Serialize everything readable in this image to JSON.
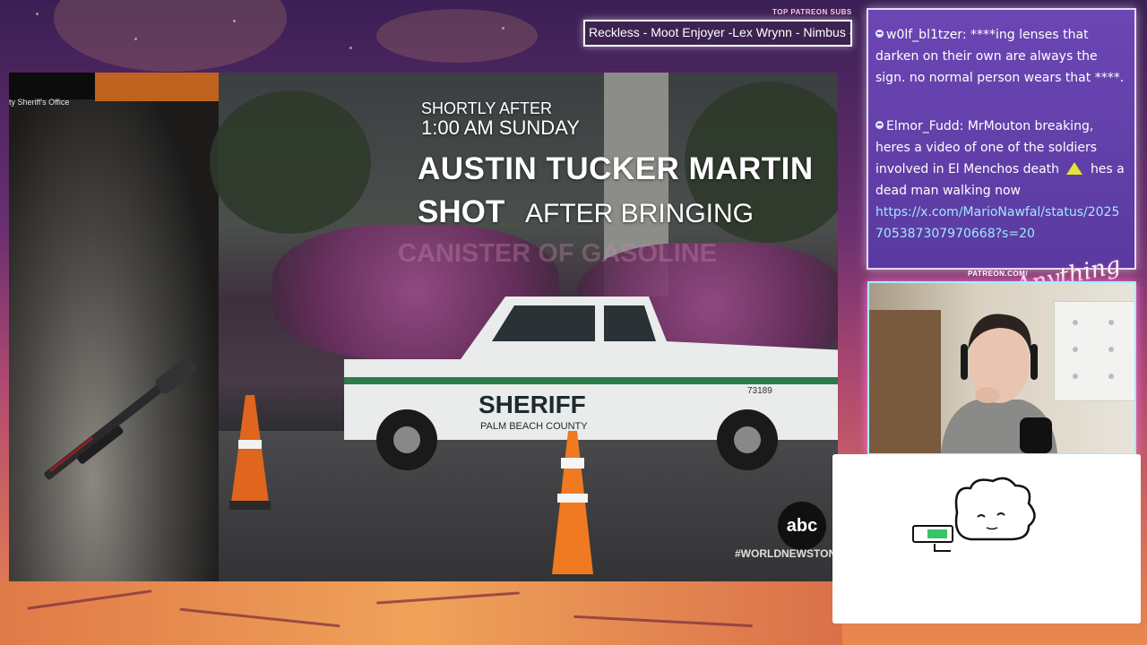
{
  "ticker": {
    "label": "TOP PATREON SUBS",
    "text": "Reckless - Moot Enjoyer -Lex Wrynn - Nimbus - "
  },
  "video": {
    "office_label": "ty Sheriff's Office",
    "news_small1": "SHORTLY AFTER",
    "news_small2": "1:00 AM  SUNDAY",
    "news_big1": "AUSTIN TUCKER MARTIN",
    "news_big2a": "SHOT",
    "news_big2b": "AFTER BRINGING",
    "news_ghost": "CANISTER OF GASOLINE",
    "truck_text": "SHERIFF",
    "truck_subtext": "PALM BEACH COUNTY",
    "truck_number": "73189",
    "network_logo": "abc",
    "hashtag": "#WORLDNEWSTON"
  },
  "chat": {
    "messages": [
      {
        "user": "w0lf_bl1tzer",
        "text": "****ing lenses that darken on their own are always the sign. no normal person wears that ****."
      },
      {
        "user": "Elmor_Fudd",
        "text_before": "MrMouton breaking, heres a video of one of the soldiers involved in El Menchos death",
        "text_after": "hes a dead man walking now",
        "link": "https://x.com/MarioNawfal/status/2025705387307970668?s=20"
      }
    ]
  },
  "webcam": {
    "patreon_label": "PATREON.COM/",
    "brand_script": "Anything else?"
  },
  "colors": {
    "chat_bg": "#6c46b4",
    "link": "#9fe8ff",
    "accent_glow": "#ff6fd8"
  }
}
